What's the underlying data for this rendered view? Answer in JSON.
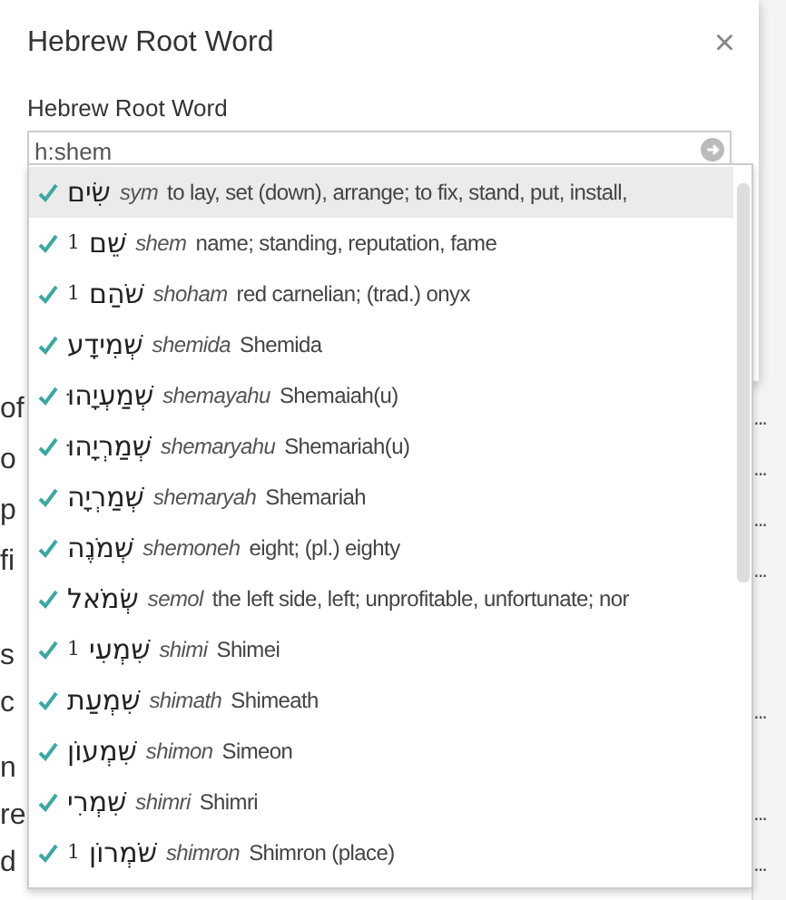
{
  "dialog": {
    "title": "Hebrew Root Word",
    "close": "×",
    "field_label": "Hebrew Root Word",
    "field_value": "h:shem"
  },
  "suggestions": [
    {
      "hebrew": "שִׂים",
      "translit": "sym",
      "gloss": "to lay, set (down), arrange; to fix, stand, put, install,",
      "selected": true
    },
    {
      "homonym": "1",
      "hebrew": "שֵׁם",
      "translit": "shem",
      "gloss": "name; standing, reputation, fame",
      "selected": false
    },
    {
      "homonym": "1",
      "hebrew": "שֹׁהַם",
      "translit": "shoham",
      "gloss": "red carnelian; (trad.) onyx",
      "selected": false
    },
    {
      "hebrew": "שְׁמִידָע",
      "translit": "shemida",
      "gloss": "Shemida",
      "selected": false
    },
    {
      "hebrew": "שְׁמַעְיָהוּ",
      "translit": "shemayahu",
      "gloss": "Shemaiah(u)",
      "selected": false
    },
    {
      "hebrew": "שְׁמַרְיָהוּ",
      "translit": "shemaryahu",
      "gloss": "Shemariah(u)",
      "selected": false
    },
    {
      "hebrew": "שְׁמַרְיָה",
      "translit": "shemaryah",
      "gloss": "Shemariah",
      "selected": false
    },
    {
      "hebrew": "שְׁמֹנֶה",
      "translit": "shemoneh",
      "gloss": "eight; (pl.) eighty",
      "selected": false
    },
    {
      "hebrew": "שְׂמֹאל",
      "translit": "semol",
      "gloss": "the left side, left; unprofitable, unfortunate; nor",
      "selected": false
    },
    {
      "homonym": "1",
      "hebrew": "שִׁמְעִי",
      "translit": "shimi",
      "gloss": "Shimei",
      "selected": false
    },
    {
      "hebrew": "שִׁמְעַת",
      "translit": "shimath",
      "gloss": "Shimeath",
      "selected": false
    },
    {
      "hebrew": "שִׁמְעוֹן",
      "translit": "shimon",
      "gloss": "Simeon",
      "selected": false
    },
    {
      "hebrew": "שִׁמְרִי",
      "translit": "shimri",
      "gloss": "Shimri",
      "selected": false
    },
    {
      "homonym": "1",
      "hebrew": "שֹׁמְרוֹן",
      "translit": "shimron",
      "gloss": "Shimron (place)",
      "selected": false
    }
  ],
  "background_text": [
    "of",
    "o",
    "p",
    "fi",
    "s",
    "c",
    "n",
    "re",
    "d"
  ],
  "background_marks": [
    "...",
    "...",
    "...",
    "...",
    "...",
    "...",
    "..."
  ]
}
